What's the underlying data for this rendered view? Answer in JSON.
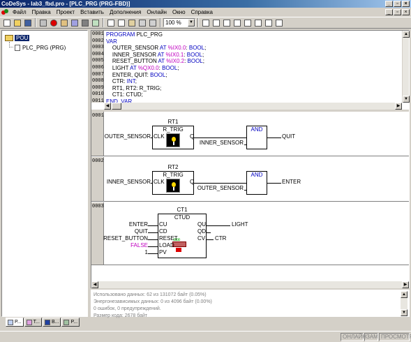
{
  "window": {
    "title": "CoDeSys - lab3_fbd.pro - [PLC_PRG (PRG-FBD)]"
  },
  "window_controls": [
    "_",
    "▫",
    "×"
  ],
  "menu": [
    "Файл",
    "Правка",
    "Проект",
    "Вставить",
    "Дополнения",
    "Онлайн",
    "Окно",
    "Справка"
  ],
  "toolbar": {
    "zoom": "100 %"
  },
  "tree": {
    "root": "POU",
    "items": [
      "PLC_PRG (PRG)"
    ]
  },
  "left_tabs": [
    "P...",
    "T...",
    "B...",
    "P..."
  ],
  "declaration": {
    "lines": [
      {
        "no": "0001",
        "kw": "PROGRAM",
        "text": " PLC_PRG",
        "addr": "",
        "kw2": "",
        "end": ""
      },
      {
        "no": "0002",
        "kw": "VAR",
        "text": "",
        "addr": "",
        "kw2": "",
        "end": ""
      },
      {
        "no": "0003",
        "kw": "",
        "text": "    OUTER_SENSOR ",
        "addr": "%IX0.0",
        "kw2": "BOOL",
        "end": ";"
      },
      {
        "no": "0004",
        "kw": "",
        "text": "    INNER_SENSOR ",
        "addr": "%IX0.1",
        "kw2": "BOOL",
        "end": ";"
      },
      {
        "no": "0005",
        "kw": "",
        "text": "    RESET_BUTTON ",
        "addr": "%IX0.2",
        "kw2": "BOOL",
        "end": ";"
      },
      {
        "no": "0006",
        "kw": "",
        "text": "    LIGHT ",
        "addr": "%QX0.0",
        "kw2": "BOOL",
        "end": ";"
      },
      {
        "no": "0007",
        "kw": "",
        "text": "    ENTER, QUIT: ",
        "addr": "",
        "kw2": "BOOL",
        "end": ";"
      },
      {
        "no": "0008",
        "kw": "",
        "text": "    CTR: ",
        "addr": "",
        "kw2": "INT",
        "end": ";"
      },
      {
        "no": "0009",
        "kw": "",
        "text": "    RT1, RT2: R_TRIG;",
        "addr": "",
        "kw2": "",
        "end": ""
      },
      {
        "no": "0010",
        "kw": "",
        "text": "    CT1: CTUD;",
        "addr": "",
        "kw2": "",
        "end": ""
      },
      {
        "no": "0011",
        "kw": "END_VAR",
        "text": "",
        "addr": "",
        "kw2": "",
        "end": ""
      }
    ],
    "at_kw": "AT"
  },
  "networks": [
    {
      "no": "0001",
      "instance": "RT1",
      "type": "R_TRIG",
      "in_var": "OUTER_SENSOR",
      "in_pin": "CLK",
      "out_pin": "Q",
      "and_label": "AND",
      "and_in2": "INNER_SENSOR",
      "out_var": "QUIT"
    },
    {
      "no": "0002",
      "instance": "RT2",
      "type": "R_TRIG",
      "in_var": "INNER_SENSOR",
      "in_pin": "CLK",
      "out_pin": "Q",
      "and_label": "AND",
      "and_in2": "OUTER_SENSOR",
      "out_var": "ENTER"
    },
    {
      "no": "0003",
      "instance": "CT1",
      "type": "CTUD",
      "inputs": [
        {
          "var": "ENTER",
          "pin": "CU"
        },
        {
          "var": "QUIT",
          "pin": "CD"
        },
        {
          "var": "RESET_BUTTON",
          "pin": "RESET"
        },
        {
          "var": "FALSE",
          "pin": "LOAD"
        },
        {
          "var": "1",
          "pin": "PV"
        }
      ],
      "outputs": [
        {
          "pin": "QU",
          "var": "LIGHT"
        },
        {
          "pin": "QD",
          "var": ""
        },
        {
          "pin": "CV",
          "var": "CTR"
        }
      ],
      "false_color": "#c000c0"
    }
  ],
  "messages": [
    "Использовано данных: 62 из 131072 байт (0.05%)",
    "Энергонезависимых данных: 0 из 4096 байт (0.00%)",
    "0 ошибок, 0 предупреждений.",
    "Размер кода: 2678 байт"
  ],
  "status": [
    "ОНЛАЙН",
    "ЗАМ",
    "ПРОСМОТР"
  ]
}
